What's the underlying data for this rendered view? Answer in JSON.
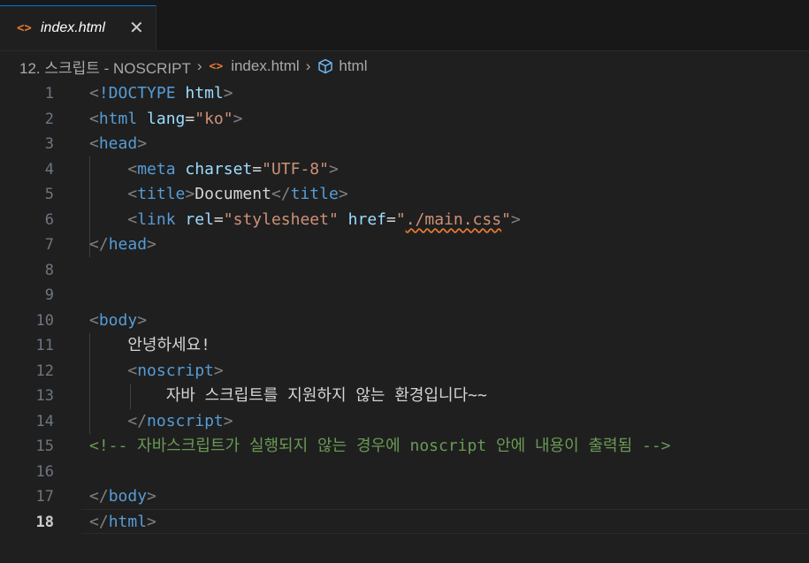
{
  "tab": {
    "icon": "<>",
    "label": "index.html",
    "close": "✕"
  },
  "breadcrumb": {
    "folder": "12. 스크립트 - NOSCRIPT",
    "file_icon": "<>",
    "file": "index.html",
    "symbol": "html",
    "separator": "›"
  },
  "editor": {
    "active_line": 18,
    "lines": [
      {
        "n": "1"
      },
      {
        "n": "2"
      },
      {
        "n": "3"
      },
      {
        "n": "4"
      },
      {
        "n": "5"
      },
      {
        "n": "6"
      },
      {
        "n": "7"
      },
      {
        "n": "8"
      },
      {
        "n": "9"
      },
      {
        "n": "10"
      },
      {
        "n": "11"
      },
      {
        "n": "12"
      },
      {
        "n": "13"
      },
      {
        "n": "14"
      },
      {
        "n": "15"
      },
      {
        "n": "16"
      },
      {
        "n": "17"
      },
      {
        "n": "18"
      }
    ],
    "code": {
      "l1": {
        "open": "<",
        "bang": "!DOCTYPE",
        "sp": " ",
        "html": "html",
        "close": ">"
      },
      "l2": {
        "open": "<",
        "tag": "html",
        "sp": " ",
        "attr": "lang",
        "eq": "=",
        "val": "\"ko\"",
        "close": ">"
      },
      "l3": {
        "open": "<",
        "tag": "head",
        "close": ">"
      },
      "l4": {
        "indent": "    ",
        "open": "<",
        "tag": "meta",
        "sp": " ",
        "attr": "charset",
        "eq": "=",
        "val": "\"UTF-8\"",
        "close": ">"
      },
      "l5": {
        "indent": "    ",
        "open": "<",
        "tag": "title",
        "close": ">",
        "text": "Document",
        "open2": "</",
        "tag2": "title",
        "close2": ">"
      },
      "l6": {
        "indent": "    ",
        "open": "<",
        "tag": "link",
        "sp": " ",
        "attr": "rel",
        "eq": "=",
        "val": "\"stylesheet\"",
        "sp2": " ",
        "attr2": "href",
        "eq2": "=",
        "q1": "\"",
        "val2": "./main.css",
        "q2": "\"",
        "close": ">"
      },
      "l7": {
        "open": "</",
        "tag": "head",
        "close": ">"
      },
      "l10": {
        "open": "<",
        "tag": "body",
        "close": ">"
      },
      "l11": {
        "indent": "    ",
        "text": "안녕하세요!"
      },
      "l12": {
        "indent": "    ",
        "open": "<",
        "tag": "noscript",
        "close": ">"
      },
      "l13": {
        "indent": "        ",
        "text": "자바 스크립트를 지원하지 않는 환경입니다~~"
      },
      "l14": {
        "indent": "    ",
        "open": "</",
        "tag": "noscript",
        "close": ">"
      },
      "l15": {
        "comment": "<!-- 자바스크립트가 실행되지 않는 경우에 noscript 안에 내용이 출력됨 -->"
      },
      "l17": {
        "open": "</",
        "tag": "body",
        "close": ">"
      },
      "l18": {
        "open": "</",
        "tag": "html",
        "close": ">"
      }
    }
  },
  "colors": {
    "background": "#1f1f1f",
    "tag": "#569cd6",
    "attribute": "#9cdcfe",
    "string": "#ce9178",
    "comment": "#6a9955",
    "accent": "#0078d4",
    "html_icon": "#e37933"
  }
}
